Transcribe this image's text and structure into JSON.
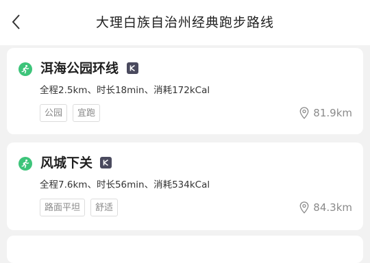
{
  "header": {
    "title": "大理白族自治州经典跑步路线"
  },
  "routes": [
    {
      "name": "洱海公园环线",
      "stats": "全程2.5km、时长18min、消耗172kCal",
      "tags": [
        "公园",
        "宜跑"
      ],
      "distance": "81.9km"
    },
    {
      "name": "风城下关",
      "stats": "全程7.6km、时长56min、消耗534kCal",
      "tags": [
        "路面平坦",
        "舒适"
      ],
      "distance": "84.3km"
    }
  ],
  "colors": {
    "run_icon": "#3dc47a",
    "k_badge": "#4a4a5e"
  },
  "icons": {
    "back": "chevron-left-icon",
    "run": "running-person-icon",
    "badge": "k-badge-icon",
    "location": "location-pin-icon"
  }
}
